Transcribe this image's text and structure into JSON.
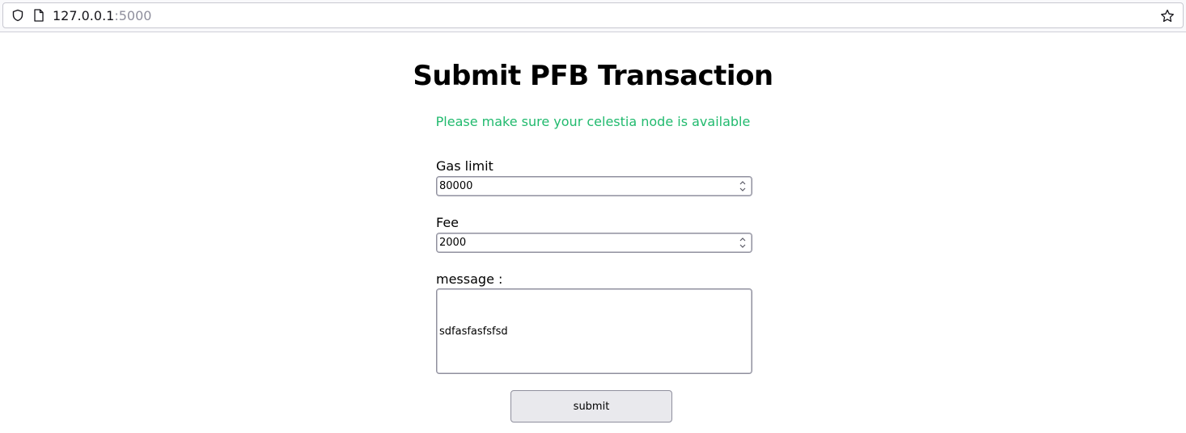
{
  "browser": {
    "url_host": "127.0.0.1",
    "url_port": ":5000",
    "icons": [
      "shield-icon",
      "page-icon",
      "star-icon"
    ]
  },
  "page": {
    "title": "Submit PFB Transaction",
    "notice": "Please make sure your celestia node is available",
    "notice_color": "#21ba6e"
  },
  "form": {
    "gas_limit_label": "Gas limit",
    "gas_limit_value": "80000",
    "fee_label": "Fee",
    "fee_value": "2000",
    "message_label": "message :",
    "message_value": "sdfasfasfsfsd",
    "submit_label": "submit"
  }
}
